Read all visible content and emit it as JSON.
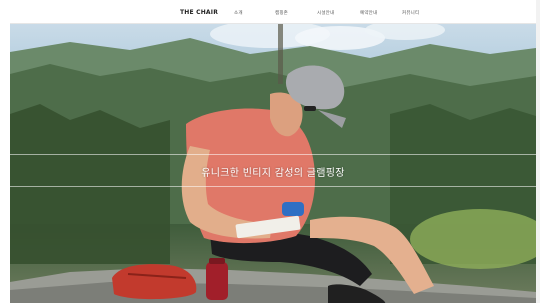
{
  "header": {
    "logo": "THE CHAIR",
    "nav": [
      {
        "label": "소개"
      },
      {
        "label": "캠핑존"
      },
      {
        "label": "시설안내"
      },
      {
        "label": "예약안내"
      },
      {
        "label": "커뮤니티"
      }
    ]
  },
  "hero": {
    "tagline": "유니크한 빈티지 감성의 글램핑장"
  },
  "colors": {
    "logo": "#222222",
    "nav_text": "#555555",
    "tagline": "#ffffff",
    "sky": "#c9dbe8",
    "forest": "#3c5a39"
  }
}
